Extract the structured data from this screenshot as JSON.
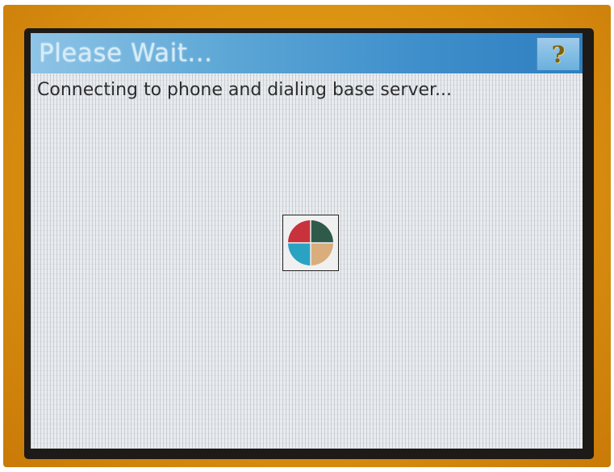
{
  "dialog": {
    "title": "Please Wait...",
    "help_icon": "question-mark-icon",
    "help_label": "?",
    "message": "Connecting to phone and dialing base server..."
  },
  "spinner": {
    "icon": "busy-spinner-icon",
    "colors": {
      "top_left": "#c8323c",
      "top_right": "#2f5a4a",
      "bottom_left": "#2aa3c3",
      "bottom_right": "#d9ad7c"
    }
  },
  "colors": {
    "device_frame": "#e09a18",
    "titlebar": "#5da7d6",
    "screen_bg": "#e9ecef"
  }
}
